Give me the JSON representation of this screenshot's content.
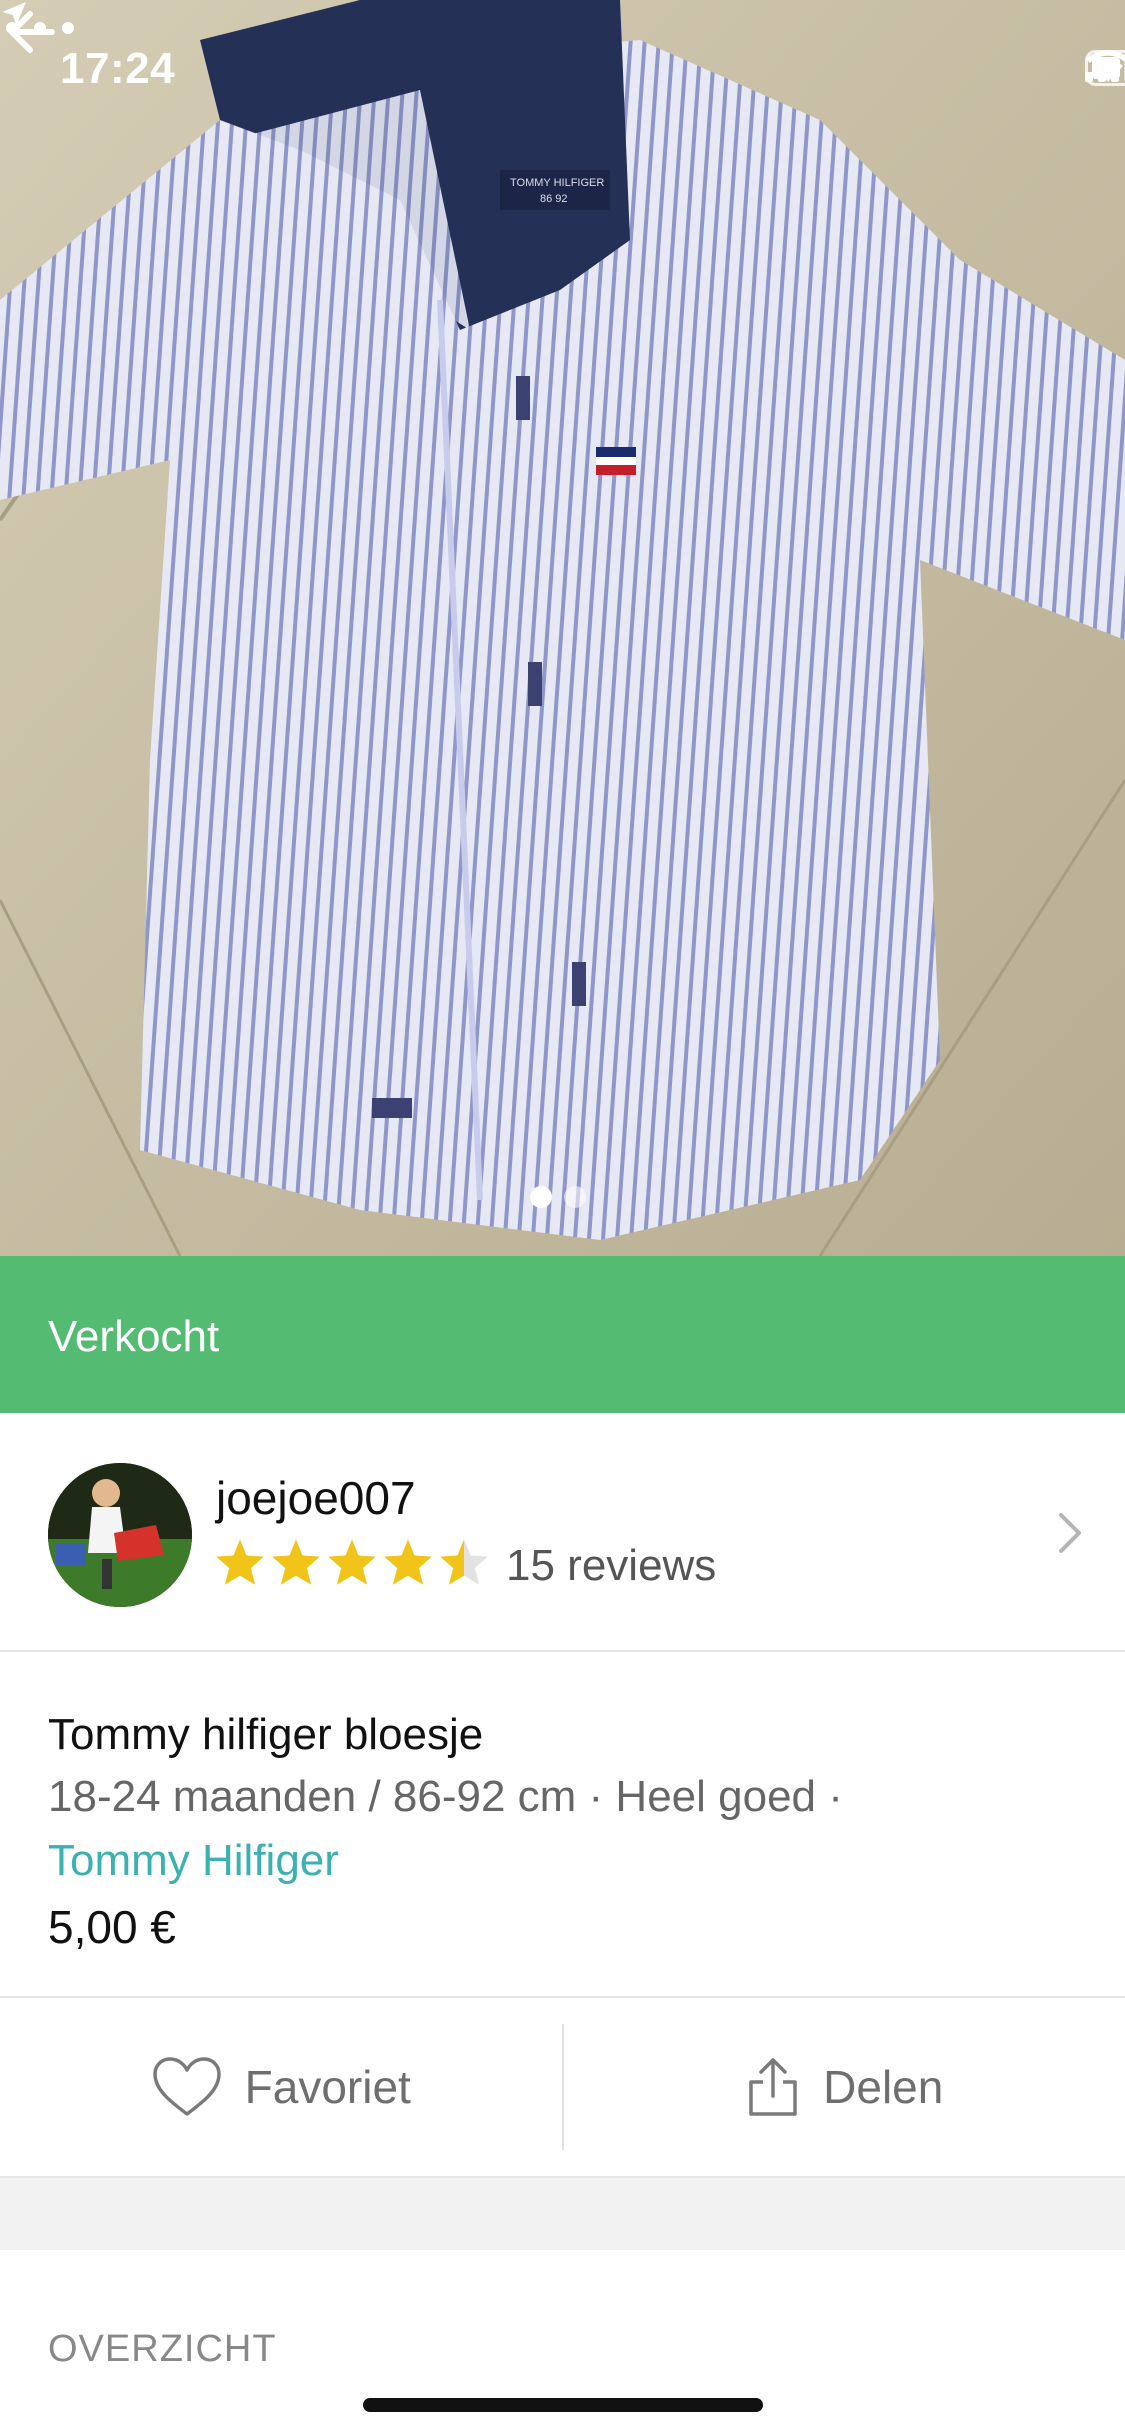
{
  "status_bar": {
    "time": "17:24"
  },
  "listing": {
    "status_banner": "Verkocht",
    "image_count": 2,
    "active_image": 1
  },
  "seller": {
    "username": "joejoe007",
    "rating": 4.5,
    "rating_max": 5,
    "reviews_label": "15 reviews"
  },
  "item": {
    "title": "Tommy hilfiger bloesje",
    "meta": "18-24 maanden / 86-92 cm · Heel goed ·",
    "brand": "Tommy Hilfiger",
    "price": "5,00 €"
  },
  "actions": {
    "favorite_label": "Favoriet",
    "share_label": "Delen"
  },
  "section": {
    "overview_label": "OVERZICHT"
  },
  "colors": {
    "sold_green": "#54bb72",
    "brand_teal": "#3bb1b0",
    "star_yellow": "#f0c419"
  },
  "icons": {
    "back": "arrow-left-icon",
    "more": "more-horizontal-icon",
    "favorite": "heart-icon",
    "share": "share-icon",
    "chevron": "chevron-right-icon"
  }
}
